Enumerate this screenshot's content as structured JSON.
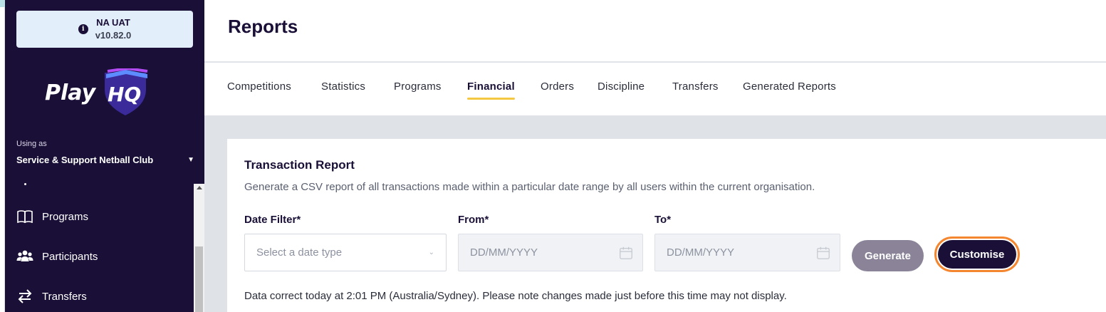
{
  "environment": {
    "name": "NA UAT",
    "version": "v10.82.0",
    "icon": "info-icon"
  },
  "brand": {
    "name": "PlayHQ"
  },
  "org": {
    "using_as_label": "Using as",
    "name": "Service & Support Netball Club"
  },
  "sidebar": {
    "items": [
      {
        "label": "Programs",
        "icon": "book-icon"
      },
      {
        "label": "Participants",
        "icon": "people-icon"
      },
      {
        "label": "Transfers",
        "icon": "transfer-arrows-icon"
      }
    ]
  },
  "page": {
    "title": "Reports"
  },
  "tabs": [
    {
      "label": "Competitions",
      "active": false
    },
    {
      "label": "Statistics",
      "active": false
    },
    {
      "label": "Programs",
      "active": false
    },
    {
      "label": "Financial",
      "active": true
    },
    {
      "label": "Orders",
      "active": false
    },
    {
      "label": "Discipline",
      "active": false
    },
    {
      "label": "Transfers",
      "active": false
    },
    {
      "label": "Generated Reports",
      "active": false
    }
  ],
  "report": {
    "title": "Transaction Report",
    "description": "Generate a CSV report of all transactions made within a particular date range by all users within the current organisation.",
    "date_filter": {
      "label": "Date Filter*",
      "placeholder": "Select a date type"
    },
    "from": {
      "label": "From*",
      "placeholder": "DD/MM/YYYY"
    },
    "to": {
      "label": "To*",
      "placeholder": "DD/MM/YYYY"
    },
    "generate_label": "Generate",
    "customise_label": "Customise",
    "note": "Data correct today at 2:01 PM (Australia/Sydney). Please note changes made just before this time may not display."
  },
  "colors": {
    "sidebar_bg": "#1a0f36",
    "accent_yellow": "#f5c842",
    "focus_orange": "#f4862f",
    "generate_disabled": "#8b8499"
  }
}
